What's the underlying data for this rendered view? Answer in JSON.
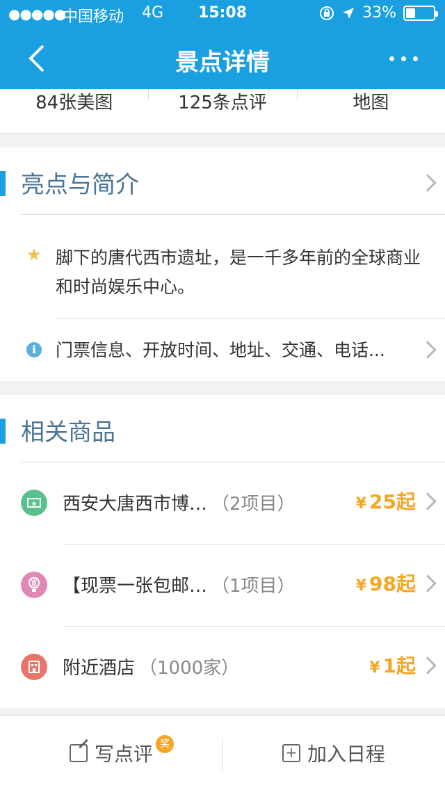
{
  "status": {
    "signal": "●●●●●",
    "carrier": "中国移动",
    "network": "4G",
    "time": "15:08",
    "battery": "33%",
    "battery_level": 0.33
  },
  "nav": {
    "title": "景点详情",
    "back_icon": "chevron-left-icon",
    "more_icon": "more-dots-icon"
  },
  "media_tabs": [
    {
      "label": "84张美图"
    },
    {
      "label": "125条点评"
    },
    {
      "label": "地图"
    }
  ],
  "intro": {
    "heading": "亮点与简介",
    "highlight": "脚下的唐代西市遗址，是一千多年前的全球商业和时尚娱乐中心。",
    "info": "门票信息、开放时间、地址、交通、电话..."
  },
  "products": {
    "heading": "相关商品",
    "items": [
      {
        "name": "西安大唐西市博…",
        "count": "（2项目）",
        "currency": "¥",
        "price": "25起",
        "icon": "ticket-icon",
        "color": "#5ac18e"
      },
      {
        "name": "【现票一张包邮…",
        "count": "（1项目）",
        "currency": "¥",
        "price": "98起",
        "icon": "balloon-icon",
        "color": "#e089b4"
      },
      {
        "name": "附近酒店",
        "count": "（1000家）",
        "currency": "¥",
        "price": "1起",
        "icon": "hotel-icon",
        "color": "#e8756b"
      }
    ]
  },
  "bottom": {
    "review_label": "写点评",
    "review_badge": "奖",
    "schedule_label": "加入日程"
  },
  "colors": {
    "brand": "#1a9fe0",
    "price": "#f5a623",
    "heading": "#4a7596"
  }
}
